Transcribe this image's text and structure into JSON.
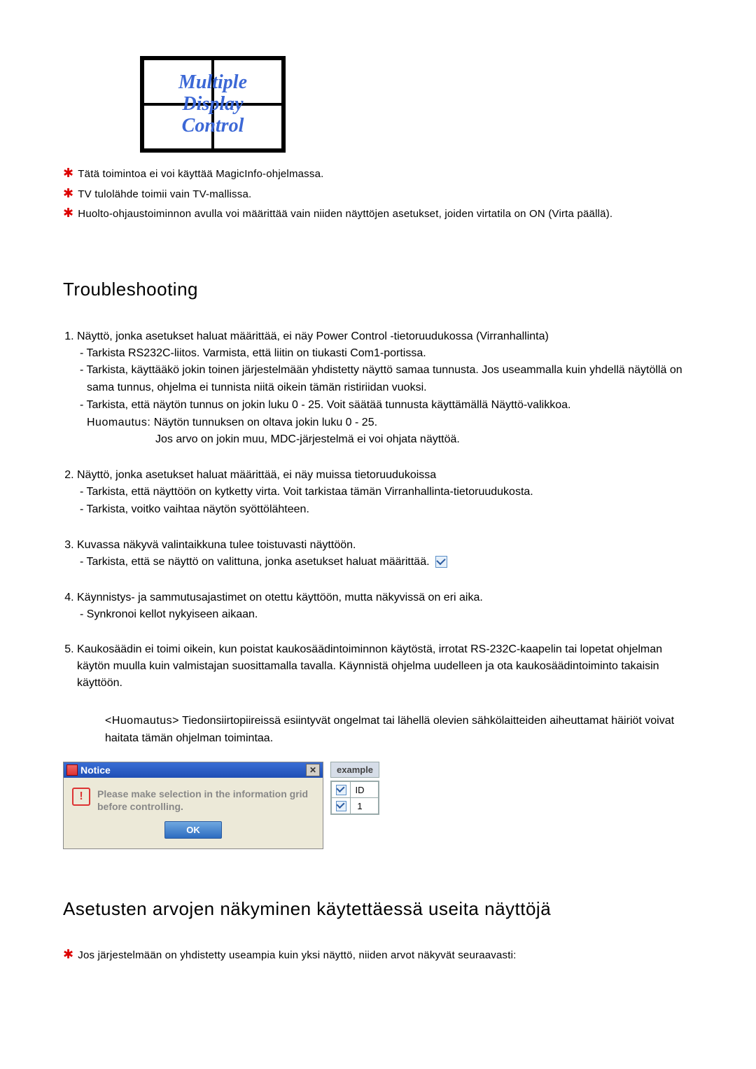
{
  "logo": {
    "line1": "Multiple",
    "line2": "Display",
    "line3": "Control"
  },
  "top_notes": [
    "Tätä toimintoa ei voi käyttää MagicInfo-ohjelmassa.",
    "TV tulolähde toimii vain TV-mallissa.",
    "Huolto-ohjaustoiminnon avulla voi määrittää vain niiden näyttöjen asetukset, joiden virtatila on ON (Virta päällä)."
  ],
  "heading1": "Troubleshooting",
  "items": [
    {
      "main": "Näyttö, jonka asetukset haluat määrittää, ei näy Power Control -tietoruudukossa (Virranhallinta)",
      "subs": [
        "Tarkista RS232C-liitos. Varmista, että liitin on tiukasti Com1-portissa.",
        "Tarkista, käyttääkö jokin toinen järjestelmään yhdistetty näyttö samaa tunnusta. Jos useammalla kuin yhdellä näytöllä on sama tunnus, ohjelma ei tunnista niitä oikein tämän ristiriidan vuoksi.",
        "Tarkista, että näytön tunnus on jokin luku 0 - 25. Voit säätää tunnusta käyttämällä Näyttö-valikkoa."
      ],
      "note_label": "Huomautus:",
      "note_lines": [
        "Näytön tunnuksen on oltava jokin luku 0 - 25.",
        "Jos arvo on jokin muu, MDC-järjestelmä ei voi ohjata näyttöä."
      ]
    },
    {
      "main": "Näyttö, jonka asetukset haluat määrittää, ei näy muissa tietoruudukoissa",
      "subs": [
        "Tarkista, että näyttöön on kytketty virta. Voit tarkistaa tämän Virranhallinta-tietoruudukosta.",
        "Tarkista, voitko vaihtaa näytön syöttölähteen."
      ]
    },
    {
      "main": "Kuvassa näkyvä valintaikkuna tulee toistuvasti näyttöön.",
      "subs_with_icon": "Tarkista, että se näyttö on valittuna, jonka asetukset haluat määrittää."
    },
    {
      "main": "Käynnistys- ja sammutusajastimet on otettu käyttöön, mutta näkyvissä on eri aika.",
      "subs": [
        "Synkronoi kellot nykyiseen aikaan."
      ]
    },
    {
      "main": "Kaukosäädin ei toimi oikein, kun poistat kaukosäädintoiminnon käytöstä, irrotat RS-232C-kaapelin tai lopetat ohjelman käytön muulla kuin valmistajan suosittamalla tavalla. Käynnistä ohjelma uudelleen ja ota kaukosäädintoiminto takaisin käyttöön."
    }
  ],
  "after_note_label": "<Huomautus>",
  "after_note_text": "Tiedonsiirtopiireissä esiintyvät ongelmat tai lähellä olevien sähkölaitteiden aiheuttamat häiriöt voivat haitata tämän ohjelman toimintaa.",
  "dialog": {
    "title": "Notice",
    "message": "Please make selection in the information grid before controlling.",
    "ok": "OK"
  },
  "example": {
    "label": "example",
    "header_id": "ID",
    "row_id": "1"
  },
  "heading2": "Asetusten arvojen näkyminen käytettäessä useita näyttöjä",
  "bottom_note": "Jos järjestelmään on yhdistetty useampia kuin yksi näyttö, niiden arvot näkyvät seuraavasti:"
}
